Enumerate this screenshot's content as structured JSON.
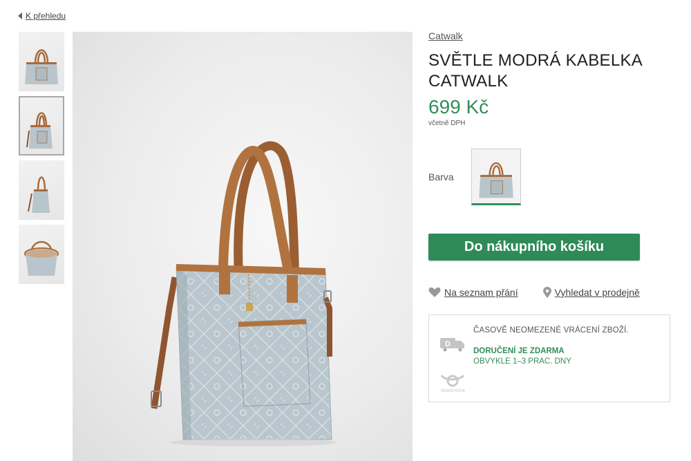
{
  "nav": {
    "back_label": "K přehledu"
  },
  "product": {
    "brand": "Catwalk",
    "title": "SVĚTLE MODRÁ KABELKA CATWALK",
    "price": "699 Kč",
    "vat_note": "včetně DPH"
  },
  "color": {
    "label": "Barva"
  },
  "actions": {
    "add_to_cart": "Do nákupního košíku",
    "wishlist": "Na seznam přání",
    "find_in_store": "Vyhledat v prodejně"
  },
  "delivery": {
    "returns": "ČASOVĚ NEOMEZENÉ VRÁCENÍ ZBOŽÍ.",
    "free_shipping": "DORUČENÍ JE ZDARMA",
    "lead_time": "OBVYKLE 1–3 PRAC. DNY",
    "carrier_logo_text": "ČESKÁ POŠTA"
  },
  "icons": {
    "back": "caret-left-icon",
    "wishlist": "heart-icon",
    "store": "map-pin-icon",
    "truck": "delivery-truck-icon",
    "carrier": "ceska-posta-logo"
  },
  "colors": {
    "accent_green": "#2e8b57",
    "price_green": "#2f8f5a",
    "bag_body": "#b9c5cc",
    "bag_leather": "#a86b3c"
  }
}
